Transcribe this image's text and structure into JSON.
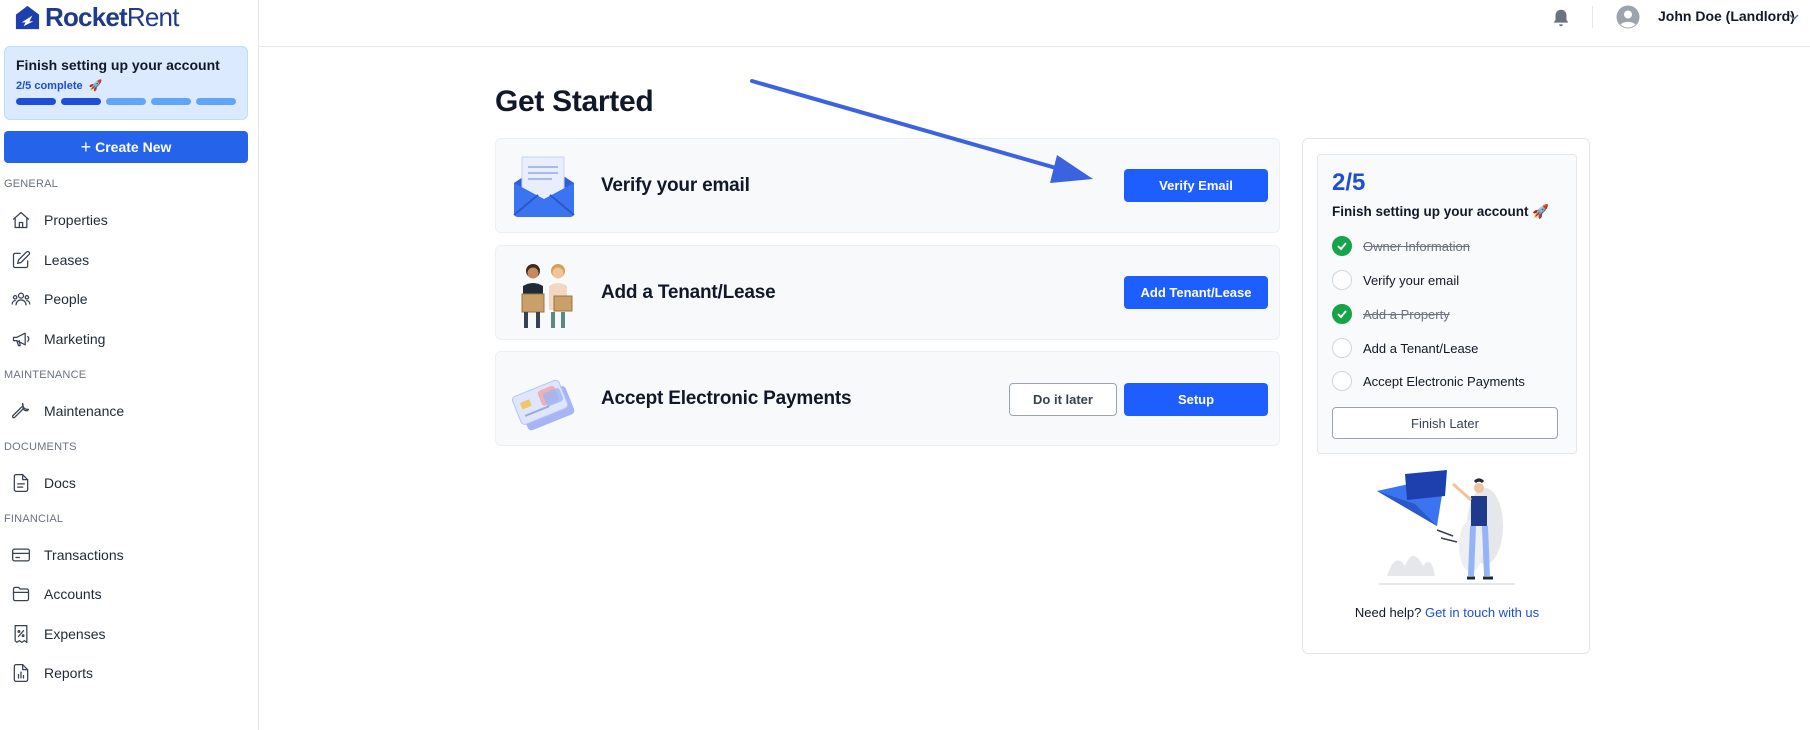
{
  "app": {
    "logo_bold": "Rocket",
    "logo_light": "Rent"
  },
  "sidebar": {
    "setup": {
      "title": "Finish setting up your account",
      "progress": "2/5 complete",
      "emoji": "🚀",
      "steps_done": 2,
      "steps_total": 5
    },
    "create_label": "Create New",
    "sections": [
      {
        "label": "GENERAL",
        "items": [
          {
            "label": "Properties",
            "icon": "home-icon"
          },
          {
            "label": "Leases",
            "icon": "edit-icon"
          },
          {
            "label": "People",
            "icon": "people-icon"
          },
          {
            "label": "Marketing",
            "icon": "megaphone-icon"
          }
        ]
      },
      {
        "label": "MAINTENANCE",
        "items": [
          {
            "label": "Maintenance",
            "icon": "wrench-icon"
          }
        ]
      },
      {
        "label": "DOCUMENTS",
        "items": [
          {
            "label": "Docs",
            "icon": "document-icon"
          }
        ]
      },
      {
        "label": "FINANCIAL",
        "items": [
          {
            "label": "Transactions",
            "icon": "credit-card-icon"
          },
          {
            "label": "Accounts",
            "icon": "folder-icon"
          },
          {
            "label": "Expenses",
            "icon": "receipt-icon"
          },
          {
            "label": "Reports",
            "icon": "report-icon"
          }
        ]
      }
    ]
  },
  "header": {
    "user_name": "John Doe (Landlord)"
  },
  "main": {
    "title": "Get Started",
    "tasks": [
      {
        "title": "Verify your email",
        "primary": "Verify Email",
        "illustration": "envelope-illustration"
      },
      {
        "title": "Add a Tenant/Lease",
        "primary": "Add Tenant/Lease",
        "illustration": "tenants-illustration"
      },
      {
        "title": "Accept Electronic Payments",
        "primary": "Setup",
        "secondary": "Do it later",
        "illustration": "cards-illustration"
      }
    ]
  },
  "progress_panel": {
    "count": "2/5",
    "subtitle": "Finish setting up your account",
    "emoji": "🚀",
    "items": [
      {
        "label": "Owner Information",
        "done": true
      },
      {
        "label": "Verify your email",
        "done": false
      },
      {
        "label": "Add a Property",
        "done": true
      },
      {
        "label": "Add a Tenant/Lease",
        "done": false
      },
      {
        "label": "Accept Electronic Payments",
        "done": false
      }
    ],
    "finish_label": "Finish Later",
    "help_text": "Need help?",
    "help_link": "Get in touch with us"
  },
  "colors": {
    "brand": "#1e3a8a",
    "accent": "#1e5eff",
    "success": "#16a34a",
    "annotation_arrow": "#3b63e0"
  }
}
